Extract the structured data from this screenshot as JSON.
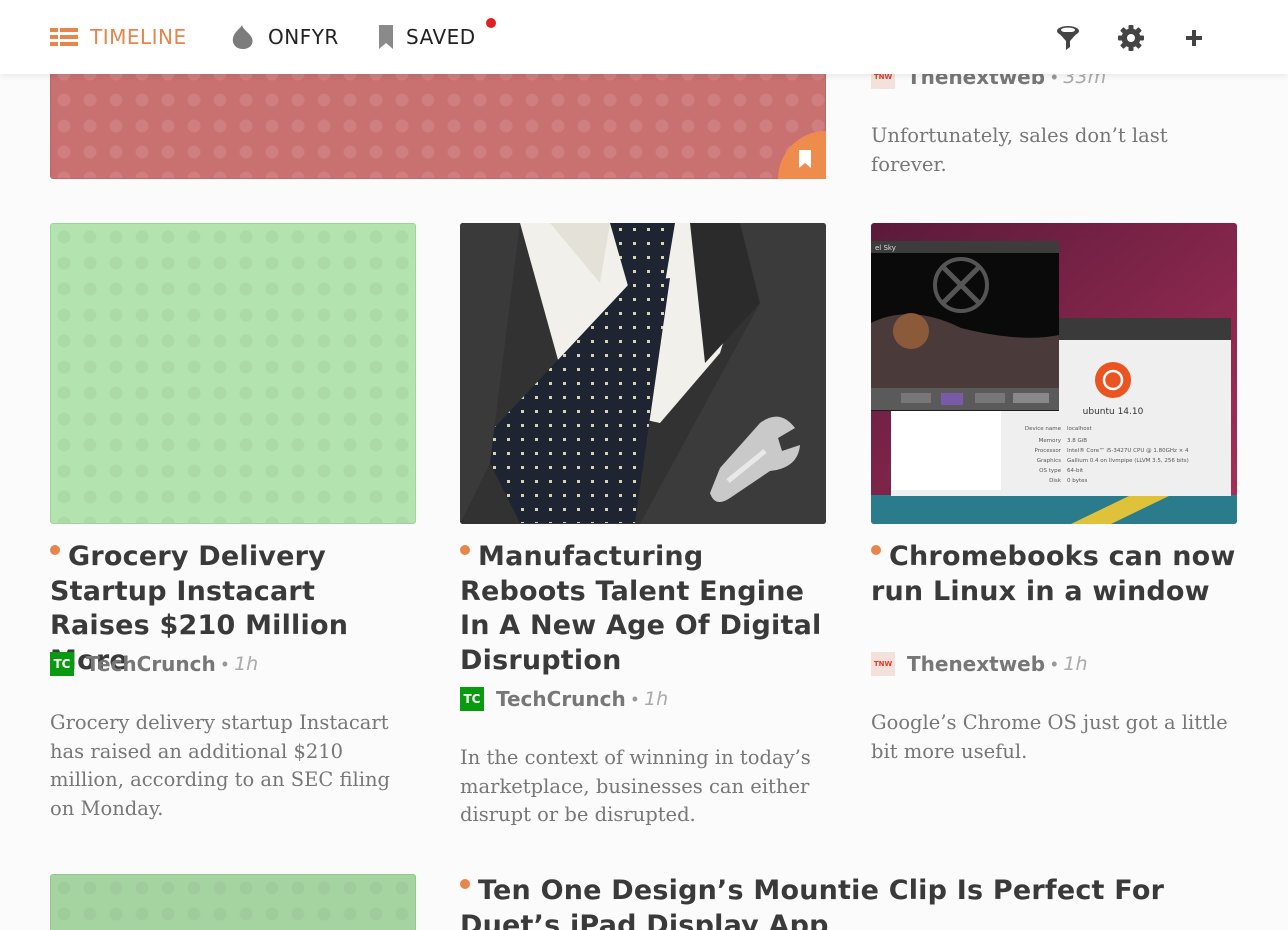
{
  "nav": {
    "timeline_label": "TIMELINE",
    "onfyr_label": "ONFYR",
    "saved_label": "SAVED",
    "accent": "#e8854a",
    "badge_color": "#e02020",
    "tools": [
      "filter-icon",
      "gear-icon",
      "plus-icon"
    ]
  },
  "top_card": {
    "source": "Thenextweb",
    "time": "33m",
    "excerpt": "Unfortunately, sales don’t last forever."
  },
  "cards": [
    {
      "title": "Grocery Delivery Startup Instacart Raises $210 Million More",
      "source": "TechCrunch",
      "time": "1h",
      "excerpt": "Grocery delivery startup Instacart has raised an additional $210 million, according to an SEC filing on Monday."
    },
    {
      "title": "Manufacturing Reboots Talent Engine In A New Age Of Digital Disruption",
      "source": "TechCrunch",
      "time": "1h",
      "excerpt": "In the context of winning in today’s marketplace, businesses can either disrupt or be disrupted."
    },
    {
      "title": "Chromebooks can now run Linux in a window",
      "source": "Thenextweb",
      "time": "1h",
      "excerpt": "Google’s Chrome OS just got a little bit more useful.",
      "screenshot": {
        "window_title": "el Sky",
        "distro": "ubuntu 14.10",
        "specs": [
          [
            "Device name",
            "localhost"
          ],
          [
            "Memory",
            "3.8 GiB"
          ],
          [
            "Processor",
            "Intel® Core™ i5-3427U CPU @ 1.80GHz × 4"
          ],
          [
            "Graphics",
            "Gallium 0.4 on llvmpipe (LLVM 3.5, 256 bits)"
          ],
          [
            "OS type",
            "64-bit"
          ],
          [
            "Disk",
            "0 bytes"
          ]
        ]
      }
    }
  ],
  "bottom_card": {
    "title": "Ten One Design’s Mountie Clip Is Perfect For Duet’s iPad Display App"
  },
  "logos": {
    "techcrunch": "TC",
    "thenextweb": "TNW"
  }
}
